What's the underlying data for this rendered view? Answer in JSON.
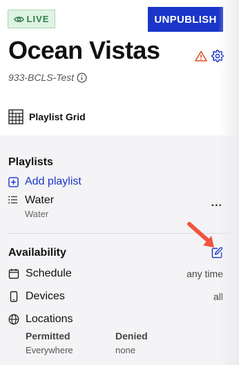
{
  "status_badge": {
    "label": "LIVE",
    "color": "#2f7d46"
  },
  "header": {
    "unpublish_label": "UNPUBLISH",
    "title": "Ocean Vistas",
    "subtitle": "933-BCLS-Test",
    "layout_label": "Playlist Grid",
    "icons": [
      "eye-icon",
      "warning-icon",
      "gear-icon",
      "info-icon",
      "grid-layout-icon"
    ]
  },
  "playlists": {
    "heading": "Playlists",
    "add_label": "Add playlist",
    "items": [
      {
        "name": "Water",
        "sub": "Water"
      }
    ],
    "more_label": "..."
  },
  "availability": {
    "heading": "Availability",
    "rows": [
      {
        "label": "Schedule",
        "value": "any time",
        "icon": "calendar-icon"
      },
      {
        "label": "Devices",
        "value": "all",
        "icon": "device-icon"
      },
      {
        "label": "Locations",
        "value": "",
        "icon": "globe-icon"
      }
    ],
    "locations": {
      "permitted_header": "Permitted",
      "denied_header": "Denied",
      "permitted_value": "Everywhere",
      "denied_value": "none"
    }
  },
  "colors": {
    "accent": "#1a35c9",
    "warning": "#e0502a",
    "arrow": "#f0553f",
    "panel": "#f4f4f6"
  }
}
